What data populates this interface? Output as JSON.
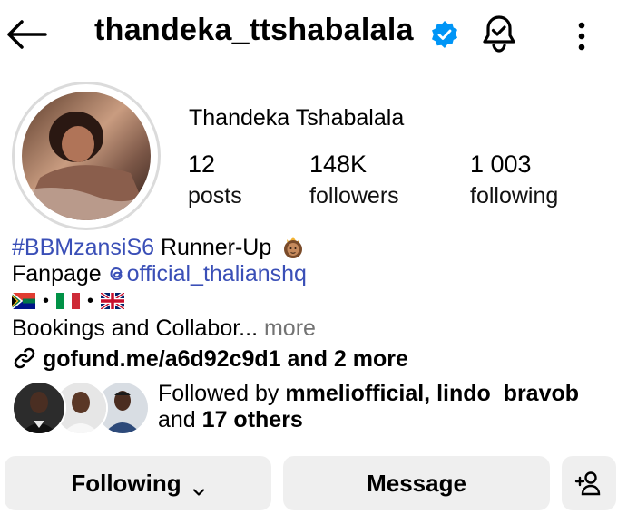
{
  "header": {
    "username": "thandeka_ttshabalala"
  },
  "profile": {
    "display_name": "Thandeka Tshabalala",
    "stats": {
      "posts_count": "12",
      "posts_label": "posts",
      "followers_count": "148K",
      "followers_label": "followers",
      "following_count": "1 003",
      "following_label": "following"
    }
  },
  "bio": {
    "hashtag": "#BBMzansiS6",
    "runner_up": " Runner-Up",
    "fanpage_prefix": "Fanpage ",
    "mention_icon": "threads-icon",
    "mention": "official_thalianshq",
    "flags": [
      "south-africa-flag",
      "italy-flag",
      "uk-flag"
    ],
    "flag_separator": "•",
    "bookings": "Bookings and Collabor...",
    "more": " more"
  },
  "link": {
    "text": "gofund.me/a6d92c9d1 and 2 more"
  },
  "followed_by": {
    "prefix": "Followed by ",
    "names": "mmeliofficial, lindo_bravob",
    "and": "and ",
    "others": "17 others"
  },
  "actions": {
    "following_label": "Following",
    "message_label": "Message"
  },
  "colors": {
    "link_blue": "#3a4fb7",
    "verified_blue": "#0095f6",
    "button_bg": "#efefef",
    "muted": "#737373"
  }
}
